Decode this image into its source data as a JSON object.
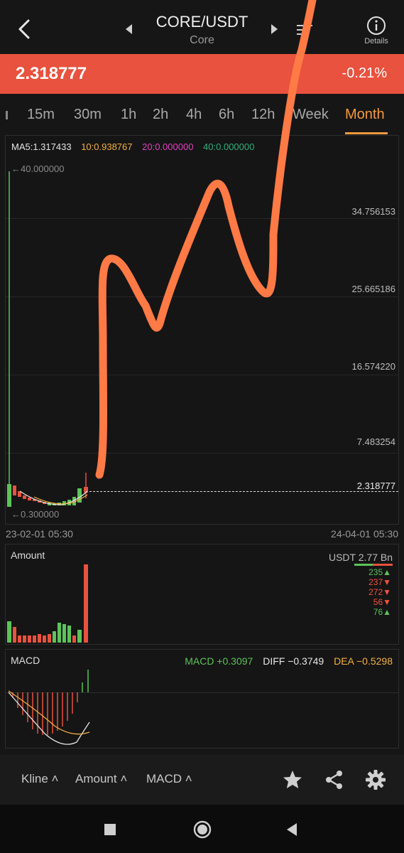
{
  "header": {
    "title": "CORE/USDT",
    "subtitle": "Core",
    "details_label": "Details"
  },
  "ticker": {
    "price": "2.318777",
    "change": "-0.21%"
  },
  "tabs": [
    {
      "label": "15m"
    },
    {
      "label": "30m"
    },
    {
      "label": "1h"
    },
    {
      "label": "2h"
    },
    {
      "label": "4h"
    },
    {
      "label": "6h"
    },
    {
      "label": "12h"
    },
    {
      "label": "Week"
    },
    {
      "label": "Month",
      "active": true
    }
  ],
  "main_chart": {
    "ma_legend": {
      "ma5": "MA5:1.317433",
      "ma10": "10:0.938767",
      "ma20": "20:0.000000",
      "ma40": "40:0.000000"
    },
    "max_label": "←40.000000",
    "min_label": "←0.300000",
    "y_labels": [
      "34.756153",
      "25.665186",
      "16.574220",
      "7.483254"
    ],
    "current_price": "2.318777",
    "date_start": "23-02-01 05:30",
    "date_end": "24-04-01 05:30"
  },
  "amount_panel": {
    "title": "Amount",
    "unit_label": "USDT 2.77 Bn",
    "legend": [
      {
        "value": "235▲",
        "dir": "up"
      },
      {
        "value": "237▼",
        "dir": "down"
      },
      {
        "value": "272▼",
        "dir": "down"
      },
      {
        "value": "56▼",
        "dir": "down"
      },
      {
        "value": "76▲",
        "dir": "up"
      }
    ]
  },
  "macd_panel": {
    "title": "MACD",
    "macd": "MACD +0.3097",
    "diff": "DIFF −0.3749",
    "dea": "DEA −0.5298"
  },
  "bottom_bar": {
    "kline": "Kline",
    "amount": "Amount",
    "macd": "MACD"
  },
  "colors": {
    "accent": "#f59a3c",
    "down": "#e8523e",
    "up": "#5cc35a",
    "ma10": "#f5b040",
    "ma20": "#e040c0",
    "ma40": "#2eb07a",
    "scribble": "#ff7a45"
  },
  "chart_data": [
    {
      "type": "candlestick",
      "title": "",
      "ylim": [
        0.3,
        40.0
      ],
      "y_ticks": [
        7.483254,
        16.57422,
        25.665186,
        34.756153
      ],
      "x_range": [
        "23-02-01 05:30",
        "24-04-01 05:30"
      ],
      "last_price": 2.318777,
      "period_high": 40.0,
      "period_low": 0.3
    },
    {
      "type": "bar",
      "title": "Amount",
      "unit": "USDT",
      "max_label": "2.77 Bn",
      "legend_values": [
        235,
        237,
        272,
        56,
        76
      ]
    },
    {
      "type": "line",
      "title": "MACD",
      "macd": 0.3097,
      "diff": -0.3749,
      "dea": -0.5298
    }
  ]
}
